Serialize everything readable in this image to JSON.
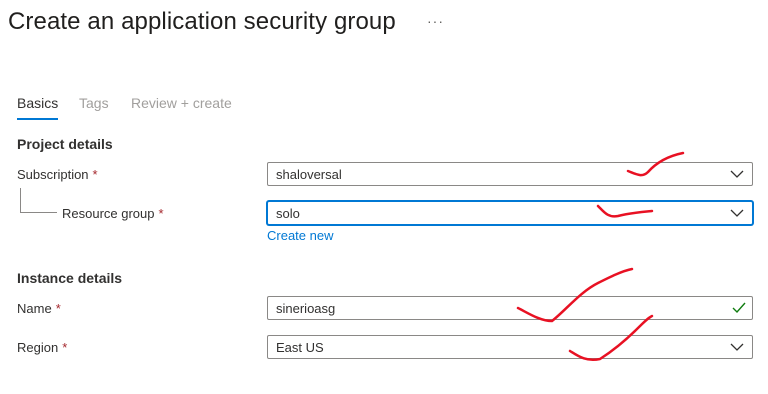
{
  "header": {
    "title": "Create an application security group",
    "more_label": "···"
  },
  "tabs": [
    {
      "label": "Basics",
      "active": true
    },
    {
      "label": "Tags",
      "active": false
    },
    {
      "label": "Review + create",
      "active": false
    }
  ],
  "project_details": {
    "heading": "Project details",
    "subscription": {
      "label": "Subscription",
      "required": "*",
      "value": "shaloversal"
    },
    "resource_group": {
      "label": "Resource group",
      "required": "*",
      "value": "solo",
      "create_new": "Create new"
    }
  },
  "instance_details": {
    "heading": "Instance details",
    "name": {
      "label": "Name",
      "required": "*",
      "value": "sinerioasg"
    },
    "region": {
      "label": "Region",
      "required": "*",
      "value": "East US"
    }
  },
  "colors": {
    "accent": "#0078d4",
    "required": "#a4262c",
    "valid_check": "#107c10",
    "annotation": "#e81123"
  }
}
